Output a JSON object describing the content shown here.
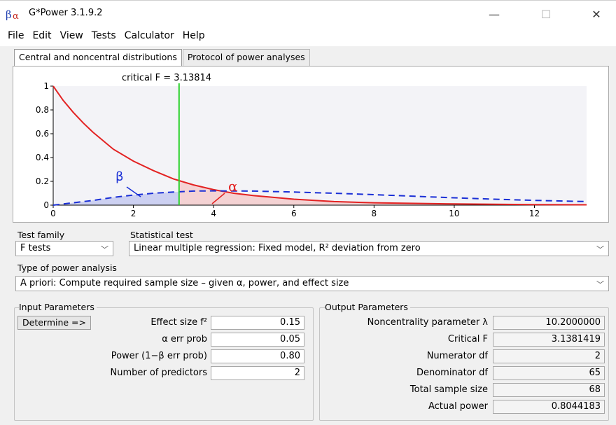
{
  "window": {
    "title": "G*Power 3.1.9.2",
    "minimize_glyph": "—",
    "maximize_glyph": "☐",
    "close_glyph": "✕"
  },
  "menu": [
    "File",
    "Edit",
    "View",
    "Tests",
    "Calculator",
    "Help"
  ],
  "tabs": [
    {
      "label": "Central and noncentral distributions",
      "active": true
    },
    {
      "label": "Protocol of power analyses",
      "active": false
    }
  ],
  "plot": {
    "critical_label": "critical F =  3.13814",
    "beta_symbol": "β",
    "alpha_symbol": "α",
    "colors": {
      "central": "#e32222",
      "noncentral": "#1a2fd6",
      "critical": "#2bd22b",
      "shade": "#c8ccef"
    }
  },
  "chart_data": {
    "type": "line",
    "title": "",
    "xlabel": "",
    "ylabel": "",
    "xlim": [
      0,
      13.3
    ],
    "ylim": [
      0,
      1
    ],
    "x_ticks": [
      "0",
      "2",
      "4",
      "6",
      "8",
      "10",
      "12"
    ],
    "y_ticks": [
      "0",
      "0.2",
      "0.4",
      "0.6",
      "0.8",
      "1"
    ],
    "critical_f": 3.13814,
    "series": [
      {
        "style": "solid red (central F distribution)",
        "x": [
          0,
          0.25,
          0.5,
          0.75,
          1,
          1.5,
          2,
          2.5,
          3,
          3.5,
          4,
          4.5,
          5,
          6,
          7,
          8,
          10,
          12,
          13.3
        ],
        "y": [
          1.0,
          0.88,
          0.78,
          0.69,
          0.61,
          0.47,
          0.37,
          0.29,
          0.22,
          0.17,
          0.13,
          0.1,
          0.08,
          0.05,
          0.03,
          0.02,
          0.01,
          0.005,
          0.003
        ]
      },
      {
        "style": "dashed blue (noncentral F distribution)",
        "x": [
          0,
          0.5,
          1,
          1.5,
          2,
          2.5,
          3,
          3.5,
          4,
          5,
          6,
          7,
          8,
          9,
          10,
          11,
          12,
          13.3
        ],
        "y": [
          0.0,
          0.02,
          0.04,
          0.065,
          0.085,
          0.1,
          0.11,
          0.118,
          0.12,
          0.118,
          0.11,
          0.1,
          0.088,
          0.075,
          0.062,
          0.05,
          0.04,
          0.03
        ]
      }
    ]
  },
  "test_family": {
    "label": "Test family",
    "value": "F tests"
  },
  "statistical_test": {
    "label": "Statistical test",
    "value": "Linear multiple regression: Fixed model, R² deviation from zero"
  },
  "power_analysis": {
    "label": "Type of power analysis",
    "value": "A priori: Compute required sample size – given α, power, and effect size"
  },
  "input": {
    "title": "Input Parameters",
    "determine_label": "Determine =>",
    "rows": [
      {
        "label": "Effect size f²",
        "value": "0.15"
      },
      {
        "label": "α err prob",
        "value": "0.05"
      },
      {
        "label": "Power (1−β err prob)",
        "value": "0.80"
      },
      {
        "label": "Number of predictors",
        "value": "2"
      }
    ]
  },
  "output": {
    "title": "Output Parameters",
    "rows": [
      {
        "label": "Noncentrality parameter λ",
        "value": "10.2000000"
      },
      {
        "label": "Critical F",
        "value": "3.1381419"
      },
      {
        "label": "Numerator df",
        "value": "2"
      },
      {
        "label": "Denominator df",
        "value": "65"
      },
      {
        "label": "Total sample size",
        "value": "68"
      },
      {
        "label": "Actual power",
        "value": "0.8044183"
      }
    ]
  }
}
